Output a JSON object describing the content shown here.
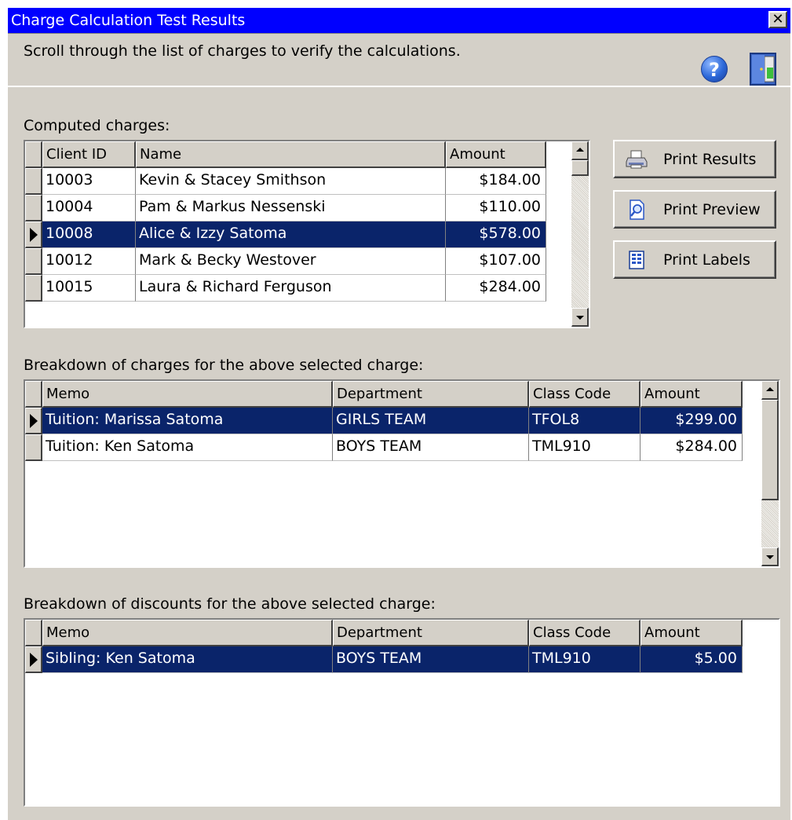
{
  "window": {
    "title": "Charge Calculation Test Results",
    "close_glyph": "✕"
  },
  "banner": {
    "text": "Scroll through the list of charges to verify the calculations.",
    "help_glyph": "?",
    "icons": [
      "help-icon",
      "exit-door-icon"
    ]
  },
  "charges": {
    "label": "Computed charges:",
    "columns": [
      "Client ID",
      "Name",
      "Amount"
    ],
    "rows": [
      {
        "client_id": "10003",
        "name": "Kevin & Stacey Smithson",
        "amount": "$184.00"
      },
      {
        "client_id": "10004",
        "name": "Pam & Markus Nessenski",
        "amount": "$110.00"
      },
      {
        "client_id": "10008",
        "name": "Alice & Izzy Satoma",
        "amount": "$578.00"
      },
      {
        "client_id": "10012",
        "name": "Mark & Becky Westover",
        "amount": "$107.00"
      },
      {
        "client_id": "10015",
        "name": "Laura & Richard Ferguson",
        "amount": "$284.00"
      }
    ],
    "selected_client_id": "10008"
  },
  "buttons": {
    "print_results": "Print Results",
    "print_preview": "Print Preview",
    "print_labels": "Print Labels",
    "icons": [
      "printer-icon",
      "magnifier-page-icon",
      "labels-grid-icon"
    ]
  },
  "charge_breakdown": {
    "label": "Breakdown of charges for the above selected charge:",
    "columns": [
      "Memo",
      "Department",
      "Class Code",
      "Amount"
    ],
    "rows": [
      {
        "memo": "Tuition: Marissa Satoma",
        "department": "GIRLS TEAM",
        "class_code": "TFOL8",
        "amount": "$299.00"
      },
      {
        "memo": "Tuition: Ken Satoma",
        "department": "BOYS TEAM",
        "class_code": "TML910",
        "amount": "$284.00"
      }
    ]
  },
  "discount_breakdown": {
    "label": "Breakdown of discounts for the above selected charge:",
    "columns": [
      "Memo",
      "Department",
      "Class Code",
      "Amount"
    ],
    "rows": [
      {
        "memo": "Sibling: Ken Satoma",
        "department": "BOYS TEAM",
        "class_code": "TML910",
        "amount": "$5.00"
      }
    ]
  },
  "colors": {
    "title_bar": "#0000ff",
    "selection": "#0a246a",
    "face": "#d4d0c8"
  }
}
